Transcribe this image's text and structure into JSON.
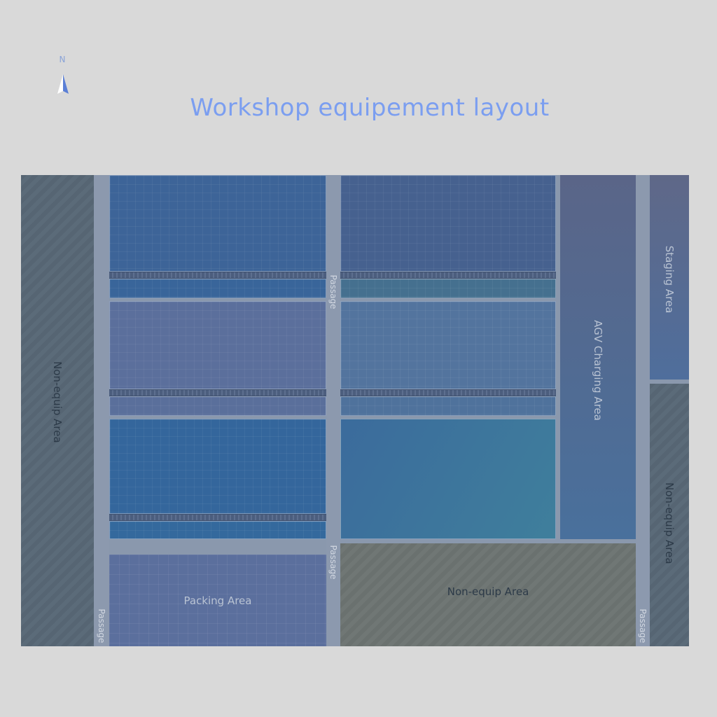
{
  "compass": {
    "label": "N"
  },
  "title": "Workshop equipement layout",
  "zones": {
    "left_non_equip": "Non-equip Area",
    "right_non_equip": "Non-equip Area",
    "bottom_non_equip": "Non-equip Area",
    "packing": "Packing Area",
    "agv_charging": "AGV Charging Area",
    "staging": "Staging Area"
  },
  "passages": {
    "left": "Passage",
    "middle_upper": "Passage",
    "middle_lower": "Passage",
    "right": "Passage"
  },
  "colors": {
    "background": "#d9d9d9",
    "title": "#7b9ef0",
    "passage": "#8c99ae",
    "non_equip": "#566573",
    "equipment": "#3f6c9c"
  }
}
